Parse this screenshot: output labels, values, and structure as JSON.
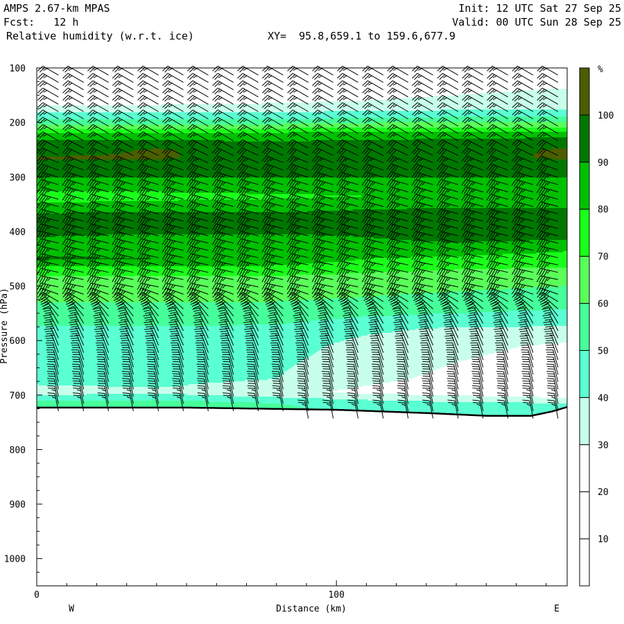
{
  "header": {
    "model": "AMPS 2.67-km MPAS",
    "init": "Init: 12 UTC Sat 27 Sep 25",
    "fcst": "Fcst:   12 h",
    "valid": "Valid: 00 UTC Sun 28 Sep 25",
    "field": "Relative humidity (w.r.t. ice)",
    "xy": "XY=  95.8,659.1 to 159.6,677.9"
  },
  "chart_data": {
    "type": "heatmap",
    "title": "Relative humidity (w.r.t. ice)",
    "xlabel": "Distance (km)",
    "ylabel": "Pressure (hPa)",
    "xlim": [
      0,
      177
    ],
    "ylim": [
      1050,
      100
    ],
    "x_ticks": [
      {
        "v": 0,
        "label": "0"
      },
      {
        "v": 100,
        "label": "100"
      }
    ],
    "y_ticks": [
      100,
      200,
      300,
      400,
      500,
      600,
      700,
      800,
      900,
      1000
    ],
    "y_tick_labels": [
      "100",
      "200",
      "300",
      "400",
      "500",
      "600",
      "700",
      "800",
      "900",
      "1000"
    ],
    "endpoint_labels": {
      "left": "W",
      "right": "E"
    },
    "colorbar": {
      "unit": "%",
      "levels": [
        10,
        20,
        30,
        40,
        50,
        60,
        70,
        80,
        90,
        100
      ],
      "level_labels": [
        "10",
        "20",
        "30",
        "40",
        "50",
        "60",
        "70",
        "80",
        "90",
        "100"
      ],
      "colors": [
        "#ffffff",
        "#ffffff",
        "#ffffff",
        "#c8ffeb",
        "#5affd2",
        "#46ff9a",
        "#5aff5a",
        "#1aff1a",
        "#00c000",
        "#007800",
        "#4b5e00"
      ]
    },
    "rh_grid": {
      "distance_km": [
        0,
        40,
        80,
        110,
        140,
        177
      ],
      "pressure_hpa": [
        100,
        160,
        175,
        190,
        205,
        220,
        235,
        250,
        265,
        280,
        300,
        320,
        335,
        350,
        370,
        390,
        410,
        430,
        450,
        470,
        490,
        520,
        550,
        580,
        610,
        640,
        670,
        695,
        715,
        740
      ],
      "rh_percent": [
        [
          20,
          25,
          35,
          45,
          62,
          82,
          92,
          95,
          101,
          95,
          90,
          85,
          72,
          82,
          92,
          96,
          90,
          84,
          92,
          76,
          66,
          62,
          56,
          48,
          45,
          44,
          44,
          35,
          55,
          60
        ],
        [
          20,
          25,
          35,
          45,
          62,
          82,
          92,
          101,
          101,
          95,
          90,
          85,
          75,
          84,
          92,
          95,
          88,
          84,
          90,
          76,
          65,
          62,
          56,
          48,
          45,
          45,
          44,
          38,
          55,
          60
        ],
        [
          20,
          28,
          35,
          45,
          62,
          82,
          90,
          95,
          96,
          95,
          90,
          86,
          78,
          84,
          92,
          95,
          88,
          82,
          88,
          75,
          66,
          62,
          55,
          48,
          45,
          42,
          40,
          32,
          50,
          55
        ],
        [
          20,
          30,
          38,
          48,
          65,
          84,
          92,
          95,
          95,
          94,
          90,
          86,
          80,
          86,
          94,
          96,
          90,
          86,
          80,
          72,
          65,
          60,
          52,
          42,
          36,
          34,
          32,
          28,
          45,
          50
        ],
        [
          20,
          32,
          38,
          50,
          66,
          85,
          92,
          97,
          98,
          95,
          90,
          86,
          82,
          88,
          95,
          98,
          94,
          86,
          78,
          70,
          64,
          58,
          50,
          38,
          33,
          30,
          28,
          25,
          42,
          50
        ],
        [
          22,
          35,
          38,
          50,
          66,
          85,
          95,
          101,
          101,
          95,
          90,
          86,
          80,
          88,
          95,
          97,
          93,
          82,
          76,
          68,
          62,
          56,
          48,
          38,
          28,
          25,
          22,
          20,
          40,
          50
        ]
      ]
    },
    "terrain": {
      "distance_km": [
        0,
        50,
        100,
        130,
        150,
        165,
        172,
        177
      ],
      "surface_pressure_hpa": [
        723,
        723,
        727,
        733,
        738,
        738,
        730,
        722
      ]
    },
    "wind": {
      "column_distance_km": [
        4,
        12.4,
        20.7,
        29,
        37.4,
        45.7,
        54,
        62.4,
        70.7,
        79,
        87.4,
        95.7,
        104,
        112.4,
        120.7,
        129,
        137.4,
        145.7,
        154,
        162.4,
        170.7
      ],
      "pressure_hpa": [
        100,
        230,
        300,
        500,
        560,
        650,
        760
      ],
      "direction_deg": [
        300,
        300,
        287,
        282,
        330,
        345,
        350
      ],
      "speed_kt": [
        25,
        25,
        45,
        45,
        35,
        30,
        25
      ]
    }
  }
}
